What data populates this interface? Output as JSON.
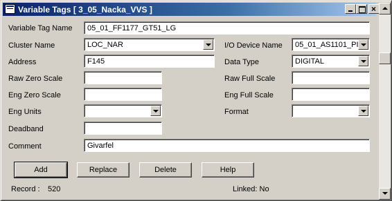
{
  "window": {
    "title": "Variable Tags [ 3_05_Nacka_VVS ]"
  },
  "form": {
    "variable_tag_name": {
      "label": "Variable Tag Name",
      "value": "05_01_FF1177_GT51_LG"
    },
    "cluster_name": {
      "label": "Cluster Name",
      "value": "LOC_NAR"
    },
    "io_device_name": {
      "label": "I/O Device Name",
      "value": "05_01_AS1101_PI"
    },
    "address": {
      "label": "Address",
      "value": "F145"
    },
    "data_type": {
      "label": "Data Type",
      "value": "DIGITAL"
    },
    "raw_zero_scale": {
      "label": "Raw Zero Scale",
      "value": ""
    },
    "raw_full_scale": {
      "label": "Raw Full Scale",
      "value": ""
    },
    "eng_zero_scale": {
      "label": "Eng Zero Scale",
      "value": ""
    },
    "eng_full_scale": {
      "label": "Eng Full Scale",
      "value": ""
    },
    "eng_units": {
      "label": "Eng Units",
      "value": ""
    },
    "format": {
      "label": "Format",
      "value": ""
    },
    "deadband": {
      "label": "Deadband",
      "value": ""
    },
    "comment": {
      "label": "Comment",
      "value": "Givarfel"
    }
  },
  "buttons": {
    "add": "Add",
    "replace": "Replace",
    "delete": "Delete",
    "help": "Help"
  },
  "status": {
    "record_label": "Record :",
    "record_value": "520",
    "linked": "Linked: No"
  },
  "colors": {
    "titlebar_start": "#0a246a",
    "titlebar_end": "#a6caf0",
    "face": "#d4d0c8"
  }
}
